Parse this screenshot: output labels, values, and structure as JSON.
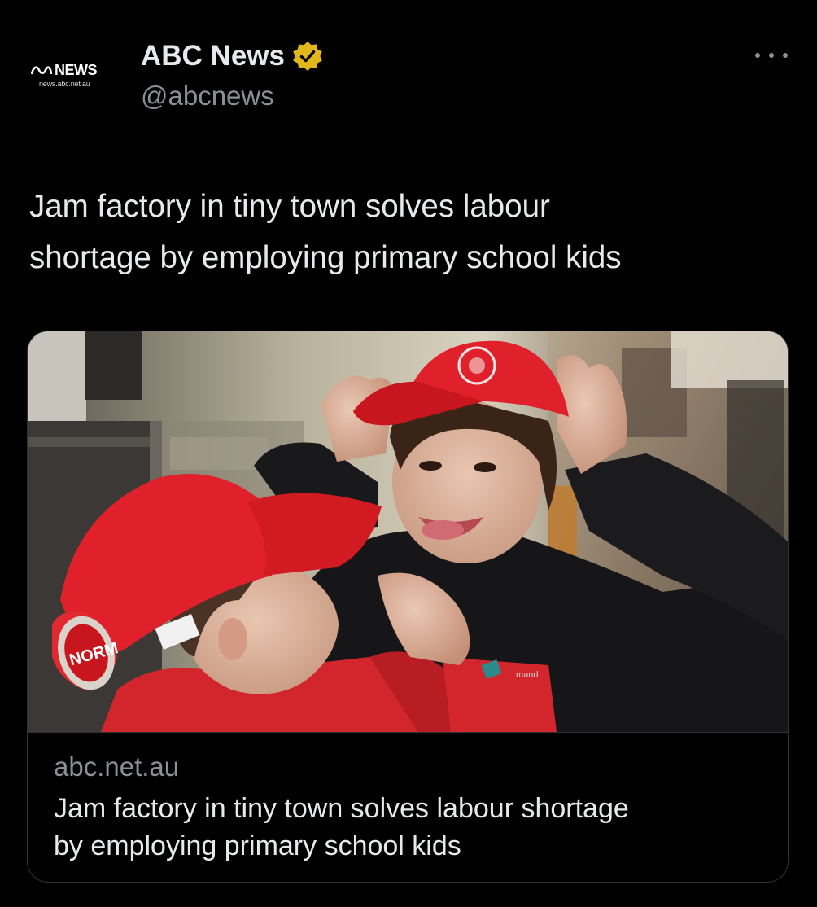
{
  "author": {
    "avatar_brand": "NEWS",
    "avatar_url": "news.abc.net.au",
    "display_name": "ABC News",
    "handle": "@abcnews",
    "verified_badge_color": "#e2b719",
    "verified_icon": "verified-badge-icon"
  },
  "tweet": {
    "text": "Jam factory in tiny town solves labour\nshortage by employing primary school kids"
  },
  "card": {
    "domain": "abc.net.au",
    "title": "Jam factory in tiny town solves labour shortage\nby employing primary school kids",
    "cap_logo_text": "NORM",
    "jacket_brand_text": "mand"
  },
  "colors": {
    "background": "#000000",
    "primary_text": "#e7e9ea",
    "secondary_text": "#8b9096",
    "border": "#2f3336",
    "cap_red": "#e0202a"
  }
}
